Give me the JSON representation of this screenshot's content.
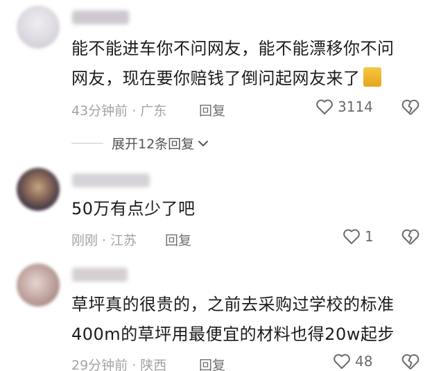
{
  "comments": [
    {
      "avatar_colors": [
        "#e9e6ec",
        "#c7c1ca"
      ],
      "text_lines": [
        "能不能进车你不问网友，能不能漂移你不问",
        "网友，现在要你赔钱了倒问起网友来了"
      ],
      "time": "43分钟前",
      "location": "广东",
      "reply": "回复",
      "likes": "3114",
      "expand": "展开12条回复"
    },
    {
      "avatar_colors": [
        "#3b3145",
        "#caa57f"
      ],
      "text_lines": [
        "50万有点少了吧"
      ],
      "time": "刚刚",
      "location": "江苏",
      "reply": "回复",
      "likes": "1"
    },
    {
      "avatar_colors": [
        "#d8c3c0",
        "#9b7b78"
      ],
      "text_lines": [
        "草坪真的很贵的，之前去采购过学校的标准",
        "400m的草坪用最便宜的材料也得20w起步"
      ],
      "time": "29分钟前",
      "location": "陕西",
      "reply": "回复",
      "likes": "48"
    }
  ],
  "meta_separator": "·",
  "icons": {
    "like": "heart-outline-icon",
    "dislike": "broken-heart-icon",
    "expand": "chevron-down-icon",
    "emoji": "cat-emoji-icon"
  }
}
